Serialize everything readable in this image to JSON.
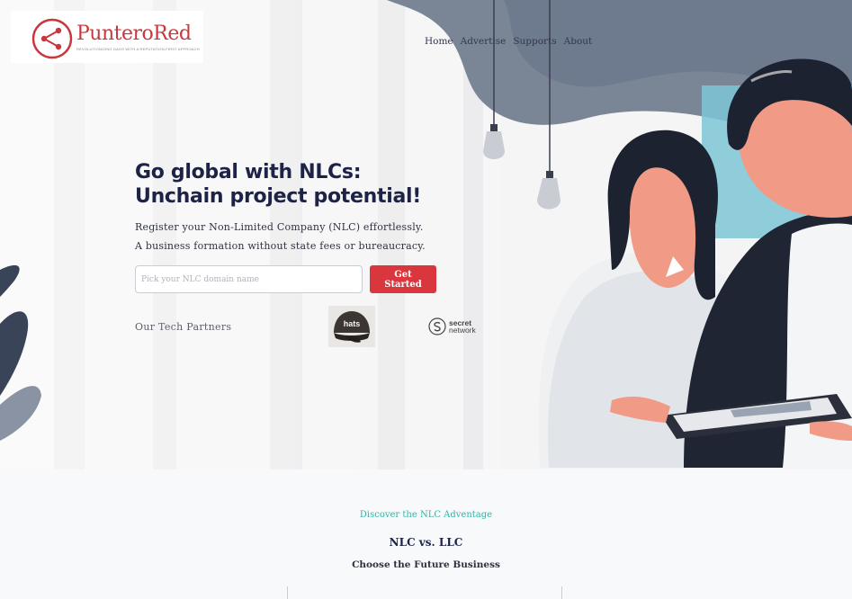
{
  "brand": {
    "name": "PunteroRed",
    "tagline": "REVOLUTIONIZING DAOS WITH A REPUTATION-FIRST APPROACH",
    "color": "#c8373d"
  },
  "nav": {
    "items": [
      {
        "label": "Home"
      },
      {
        "label": "Advertise"
      },
      {
        "label": "Supports"
      },
      {
        "label": "About"
      }
    ]
  },
  "hero": {
    "title_line1": "Go global with NLCs:",
    "title_line2": "Unchain project potential!",
    "sub_line1": "Register your Non-Limited Company (NLC) effortlessly.",
    "sub_line2": "A business formation without state fees or bureaucracy.",
    "input_placeholder": "Pick your NLC domain name",
    "input_value": "",
    "cta_label": "Get Started",
    "accent": "#d9363e"
  },
  "partners": {
    "label": "Our Tech Partners",
    "hats_text": "hats",
    "secret_word1": "secret",
    "secret_word2": "network"
  },
  "section2": {
    "eyebrow": "Discover the NLC Adventage",
    "title": "NLC vs. LLC",
    "subtitle": "Choose the Future Business",
    "eyebrow_color": "#2fb5a5"
  },
  "icons": [
    "share-network-icon",
    "hats-cap-icon",
    "secret-network-icon",
    "light-bulb-icon",
    "plant-leaf-icon"
  ]
}
